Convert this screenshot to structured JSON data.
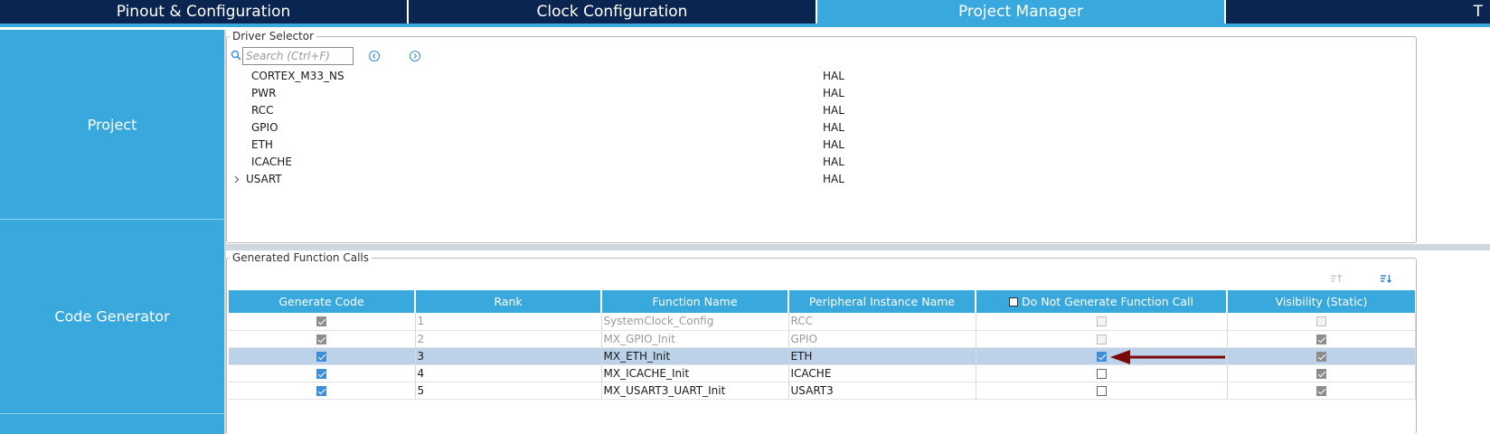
{
  "tabs": [
    {
      "label": "Pinout & Configuration",
      "active": false
    },
    {
      "label": "Clock Configuration",
      "active": false
    },
    {
      "label": "Project Manager",
      "active": true
    },
    {
      "label": "T",
      "active": false
    }
  ],
  "sidebar": {
    "items": [
      {
        "label": "Project"
      },
      {
        "label": "Code Generator"
      }
    ]
  },
  "driver_selector": {
    "legend": "Driver Selector",
    "search_placeholder": "Search (Ctrl+F)",
    "rows": [
      {
        "name": "CORTEX_M33_NS",
        "driver": "HAL",
        "expandable": false
      },
      {
        "name": "PWR",
        "driver": "HAL",
        "expandable": false
      },
      {
        "name": "RCC",
        "driver": "HAL",
        "expandable": false
      },
      {
        "name": "GPIO",
        "driver": "HAL",
        "expandable": false
      },
      {
        "name": "ETH",
        "driver": "HAL",
        "expandable": false
      },
      {
        "name": "ICACHE",
        "driver": "HAL",
        "expandable": false
      },
      {
        "name": "USART",
        "driver": "HAL",
        "expandable": true
      }
    ]
  },
  "function_calls": {
    "legend": "Generated Function Calls",
    "columns": [
      "Generate Code",
      "Rank",
      "Function Name",
      "Peripheral Instance Name",
      "Do Not Generate Function Call",
      "Visibility (Static)"
    ],
    "rows": [
      {
        "generate": true,
        "rank": "1",
        "function": "SystemClock_Config",
        "instance": "RCC",
        "do_not_generate": false,
        "visibility": false,
        "disabled": true,
        "selected": false
      },
      {
        "generate": true,
        "rank": "2",
        "function": "MX_GPIO_Init",
        "instance": "GPIO",
        "do_not_generate": false,
        "visibility": true,
        "disabled": true,
        "selected": false
      },
      {
        "generate": true,
        "rank": "3",
        "function": "MX_ETH_Init",
        "instance": "ETH",
        "do_not_generate": true,
        "visibility": true,
        "disabled": false,
        "selected": true
      },
      {
        "generate": true,
        "rank": "4",
        "function": "MX_ICACHE_Init",
        "instance": "ICACHE",
        "do_not_generate": false,
        "visibility": true,
        "disabled": false,
        "selected": false
      },
      {
        "generate": true,
        "rank": "5",
        "function": "MX_USART3_UART_Init",
        "instance": "USART3",
        "do_not_generate": false,
        "visibility": true,
        "disabled": false,
        "selected": false
      }
    ]
  },
  "colors": {
    "navy": "#0b2551",
    "accent": "#39a8dc",
    "selected_row": "#bcd2e8",
    "arrow": "#7a0a0a"
  },
  "icons": {
    "search": "search-icon",
    "previous": "chevron-left-circle-icon",
    "next": "chevron-right-circle-icon",
    "sort_up": "sort-up-icon",
    "sort_down": "sort-down-icon",
    "annotation": "red-arrow-icon"
  }
}
